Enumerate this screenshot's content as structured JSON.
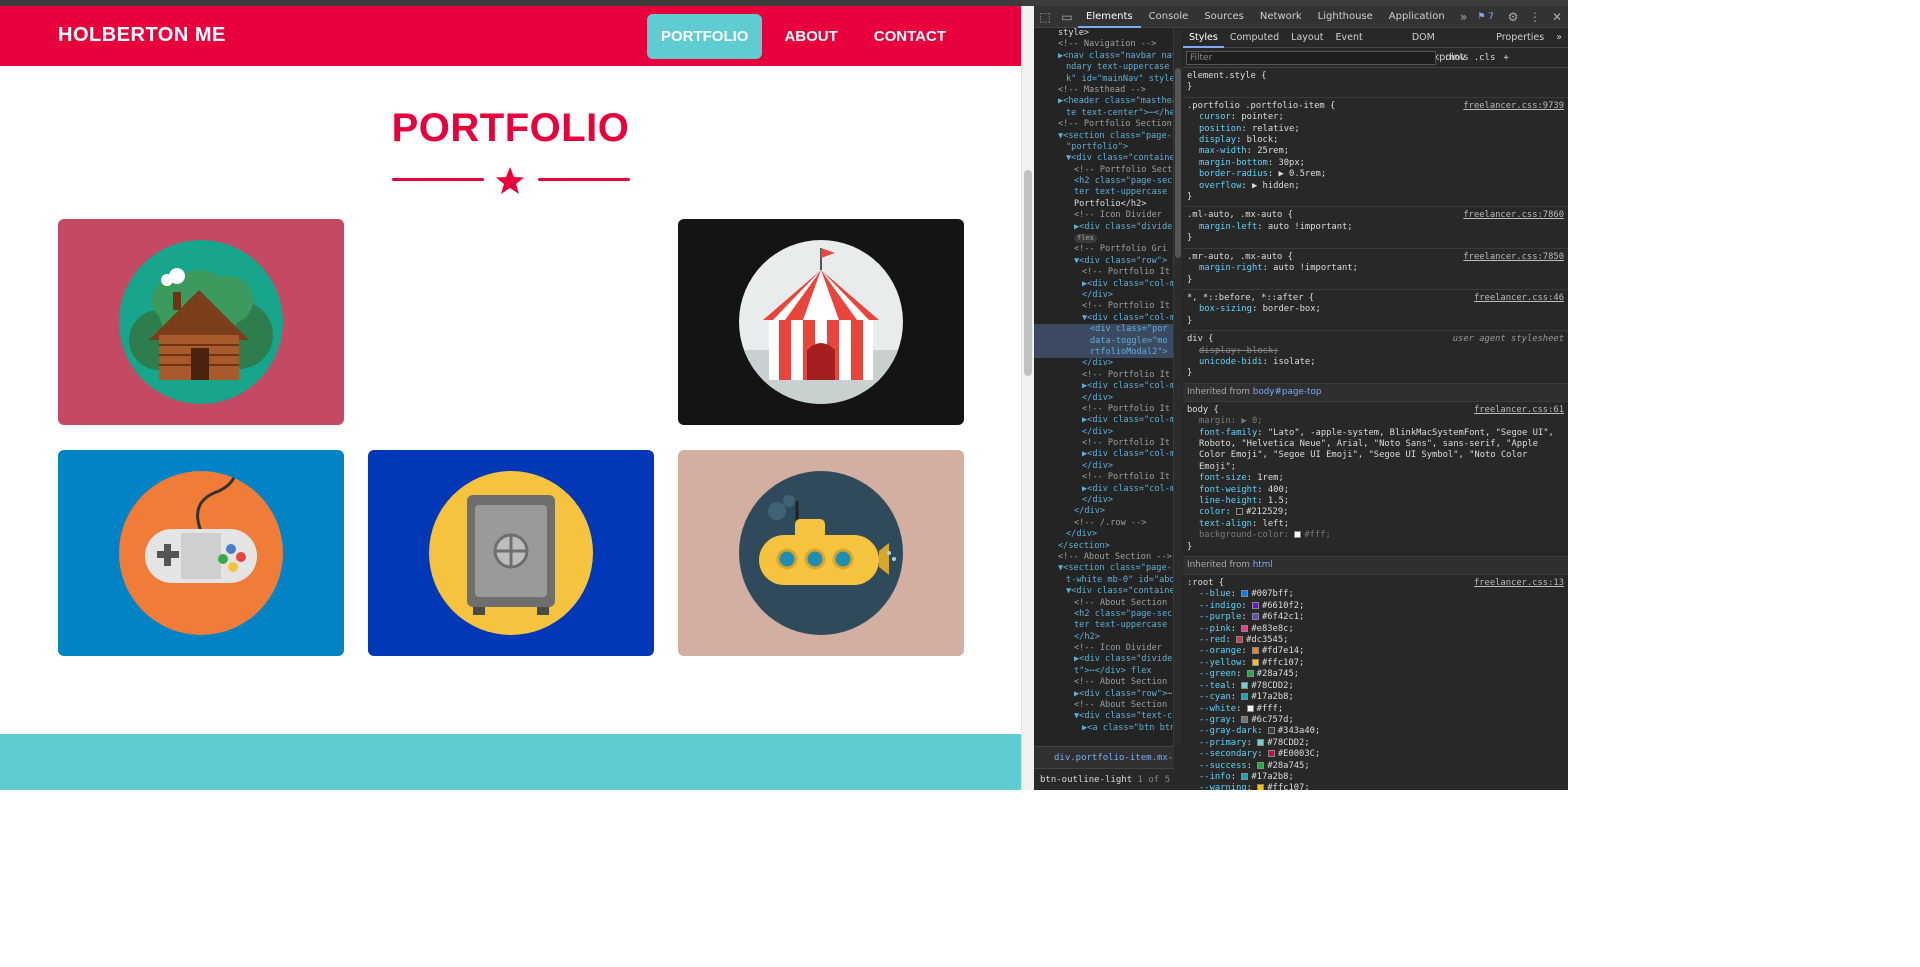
{
  "page": {
    "brand": "HOLBERTON ME",
    "nav": [
      "PORTFOLIO",
      "ABOUT",
      "CONTACT"
    ],
    "section_title": "PORTFOLIO",
    "tiles": [
      {
        "name": "cabin",
        "bg": "#C44A63",
        "circle": "#17A58C"
      },
      {
        "name": "circus",
        "bg": "#141414",
        "circle": "#E8ECEC"
      },
      {
        "name": "game-controller",
        "bg": "#0283C6",
        "circle": "#F07C37"
      },
      {
        "name": "safe",
        "bg": "#0038B8",
        "circle": "#F6C33F"
      },
      {
        "name": "submarine",
        "bg": "#D2AFA0",
        "circle": "#2F4A5A"
      }
    ],
    "colors": {
      "primary": "#E8003C",
      "accent": "#5ECCD0"
    }
  },
  "devtools": {
    "tabs": [
      "Elements",
      "Console",
      "Sources",
      "Network",
      "Lighthouse",
      "Application"
    ],
    "issues_count": "7",
    "style_tabs": [
      "Styles",
      "Computed",
      "Layout",
      "Event Listeners",
      "DOM Breakpoints",
      "Properties"
    ],
    "filter_placeholder": "Filter",
    "filter_tools": [
      ":hov",
      ".cls",
      "+"
    ],
    "breadcrumb": "div.portfolio-item.mx-auto",
    "search_value": "btn-outline-light",
    "search_count": "1 of 5",
    "elements": [
      {
        "t": "text",
        "s": "style>"
      },
      {
        "t": "comment",
        "s": "<!-- Navigation -->"
      },
      {
        "t": "tag",
        "s": "▶<nav class=\"navbar nav",
        "i": 0
      },
      {
        "t": "tag",
        "s": "ndary text-uppercase f",
        "i": 1
      },
      {
        "t": "tag",
        "s": "k\" id=\"mainNav\" style>",
        "i": 1
      },
      {
        "t": "comment",
        "s": "<!-- Masthead -->"
      },
      {
        "t": "tag",
        "s": "▶<header class=\"masthea",
        "i": 0
      },
      {
        "t": "tag",
        "s": "te text-center\">⋯</he",
        "i": 1
      },
      {
        "t": "comment",
        "s": "<!-- Portfolio Section"
      },
      {
        "t": "tag",
        "s": "▼<section class=\"page-s",
        "i": 0
      },
      {
        "t": "tag",
        "s": "\"portfolio\">",
        "i": 1
      },
      {
        "t": "tag",
        "s": "▼<div class=\"containe",
        "i": 1
      },
      {
        "t": "comment",
        "s": "<!-- Portfolio Sect",
        "i": 2
      },
      {
        "t": "tag",
        "s": "<h2 class=\"page-sec",
        "i": 2
      },
      {
        "t": "tag",
        "s": "ter text-uppercase",
        "i": 2
      },
      {
        "t": "text",
        "s": "Portfolio</h2>",
        "i": 2
      },
      {
        "t": "comment",
        "s": "<!-- Icon Divider",
        "i": 2
      },
      {
        "t": "tag",
        "s": "▶<div class=\"divide",
        "i": 2
      },
      {
        "t": "pill",
        "s": "flex",
        "i": 2
      },
      {
        "t": "comment",
        "s": "<!-- Portfolio Gri",
        "i": 2
      },
      {
        "t": "tag",
        "s": "▼<div class=\"row\">",
        "i": 2
      },
      {
        "t": "comment",
        "s": "<!-- Portfolio It",
        "i": 3
      },
      {
        "t": "tag",
        "s": "▶<div class=\"col-m",
        "i": 3
      },
      {
        "t": "tag",
        "s": "</div>",
        "i": 3
      },
      {
        "t": "comment",
        "s": "<!-- Portfolio It",
        "i": 3
      },
      {
        "t": "tag",
        "s": "▼<div class=\"col-m",
        "i": 3
      },
      {
        "t": "sel",
        "s": "<div class=\"por",
        "i": 4
      },
      {
        "t": "sel",
        "s": "data-toggle=\"mo",
        "i": 4
      },
      {
        "t": "sel",
        "s": "rtfolioModal2\">",
        "i": 4
      },
      {
        "t": "tag",
        "s": "</div>",
        "i": 3
      },
      {
        "t": "comment",
        "s": "<!-- Portfolio It",
        "i": 3
      },
      {
        "t": "tag",
        "s": "▶<div class=\"col-m",
        "i": 3
      },
      {
        "t": "tag",
        "s": "</div>",
        "i": 3
      },
      {
        "t": "comment",
        "s": "<!-- Portfolio It",
        "i": 3
      },
      {
        "t": "tag",
        "s": "▶<div class=\"col-m",
        "i": 3
      },
      {
        "t": "tag",
        "s": "</div>",
        "i": 3
      },
      {
        "t": "comment",
        "s": "<!-- Portfolio It",
        "i": 3
      },
      {
        "t": "tag",
        "s": "▶<div class=\"col-m",
        "i": 3
      },
      {
        "t": "tag",
        "s": "</div>",
        "i": 3
      },
      {
        "t": "comment",
        "s": "<!-- Portfolio It",
        "i": 3
      },
      {
        "t": "tag",
        "s": "▶<div class=\"col-m",
        "i": 3
      },
      {
        "t": "tag",
        "s": "</div>",
        "i": 3
      },
      {
        "t": "tag",
        "s": "</div>",
        "i": 2
      },
      {
        "t": "comment",
        "s": "<!-- /.row -->",
        "i": 2
      },
      {
        "t": "tag",
        "s": "</div>",
        "i": 1
      },
      {
        "t": "tag",
        "s": "</section>",
        "i": 0
      },
      {
        "t": "comment",
        "s": "<!-- About Section -->"
      },
      {
        "t": "tag",
        "s": "▼<section class=\"page-s",
        "i": 0
      },
      {
        "t": "tag",
        "s": "t-white mb-0\" id=\"abou",
        "i": 1
      },
      {
        "t": "tag",
        "s": "▼<div class=\"containe",
        "i": 1
      },
      {
        "t": "comment",
        "s": "<!-- About Section",
        "i": 2
      },
      {
        "t": "tag",
        "s": "<h2 class=\"page-sec",
        "i": 2
      },
      {
        "t": "tag",
        "s": "ter text-uppercase",
        "i": 2
      },
      {
        "t": "tag",
        "s": "</h2>",
        "i": 2
      },
      {
        "t": "comment",
        "s": "<!-- Icon Divider",
        "i": 2
      },
      {
        "t": "tag",
        "s": "▶<div class=\"divide",
        "i": 2
      },
      {
        "t": "tag",
        "s": "t\">⋯</div> flex",
        "i": 2
      },
      {
        "t": "comment",
        "s": "<!-- About Section",
        "i": 2
      },
      {
        "t": "tag",
        "s": "▶<div class=\"row\">⋯",
        "i": 2
      },
      {
        "t": "comment",
        "s": "<!-- About Section",
        "i": 2
      },
      {
        "t": "tag",
        "s": "▼<div class=\"text-c",
        "i": 2
      },
      {
        "t": "tag",
        "s": "▶<a class=\"btn btn",
        "i": 3
      }
    ],
    "rules": [
      {
        "selector": "element.style {",
        "src": "",
        "decls": []
      },
      {
        "selector": ".portfolio .portfolio-item {",
        "src": "freelancer.css:9739",
        "decls": [
          [
            "cursor",
            "pointer;"
          ],
          [
            "position",
            "relative;"
          ],
          [
            "display",
            "block;"
          ],
          [
            "max-width",
            "25rem;"
          ],
          [
            "margin-bottom",
            "30px;"
          ],
          [
            "border-radius",
            "▶ 0.5rem;"
          ],
          [
            "overflow",
            "▶ hidden;"
          ]
        ]
      },
      {
        "selector": ".ml-auto, .mx-auto {",
        "src": "freelancer.css:7860",
        "decls": [
          [
            "margin-left",
            "auto !important;"
          ]
        ]
      },
      {
        "selector": ".mr-auto, .mx-auto {",
        "src": "freelancer.css:7850",
        "decls": [
          [
            "margin-right",
            "auto !important;"
          ]
        ]
      },
      {
        "selector": "*, *::before, *::after {",
        "src": "freelancer.css:46",
        "decls": [
          [
            "box-sizing",
            "border-box;"
          ]
        ]
      },
      {
        "selector": "div {",
        "src": "user agent stylesheet",
        "ua": true,
        "decls": [
          [
            "display",
            "block;",
            "strike"
          ],
          [
            "unicode-bidi",
            "isolate;"
          ]
        ]
      }
    ],
    "inherited_body_label": "Inherited from",
    "inherited_body_link": "body#page-top",
    "body_rule": {
      "selector": "body {",
      "src": "freelancer.css:61",
      "decls": [
        [
          "margin",
          "▶ 0;",
          "dim"
        ],
        [
          "font-family",
          "\"Lato\", -apple-system, BlinkMacSystemFont, \"Segoe UI\", Roboto, \"Helvetica Neue\", Arial, \"Noto Sans\", sans-serif, \"Apple Color Emoji\", \"Segoe UI Emoji\", \"Segoe UI Symbol\", \"Noto Color Emoji\";"
        ],
        [
          "font-size",
          "1rem;"
        ],
        [
          "font-weight",
          "400;"
        ],
        [
          "line-height",
          "1.5;"
        ],
        [
          "color",
          "#212529;",
          "",
          "#212529"
        ],
        [
          "text-align",
          "left;"
        ],
        [
          "background-color",
          "#fff;",
          "dim",
          "#ffffff"
        ]
      ]
    },
    "inherited_html_label": "Inherited from",
    "inherited_html_link": "html",
    "root_rule": {
      "selector": ":root {",
      "src": "freelancer.css:13",
      "decls": [
        [
          "--blue",
          "#007bff;",
          "",
          "#007bff"
        ],
        [
          "--indigo",
          "#6610f2;",
          "",
          "#6610f2"
        ],
        [
          "--purple",
          "#6f42c1;",
          "",
          "#6f42c1"
        ],
        [
          "--pink",
          "#e83e8c;",
          "",
          "#e83e8c"
        ],
        [
          "--red",
          "#dc3545;",
          "",
          "#dc3545"
        ],
        [
          "--orange",
          "#fd7e14;",
          "",
          "#fd7e14"
        ],
        [
          "--yellow",
          "#ffc107;",
          "",
          "#ffc107"
        ],
        [
          "--green",
          "#28a745;",
          "",
          "#28a745"
        ],
        [
          "--teal",
          "#78CDD2;",
          "",
          "#78CDD2"
        ],
        [
          "--cyan",
          "#17a2b8;",
          "",
          "#17a2b8"
        ],
        [
          "--white",
          "#fff;",
          "",
          "#ffffff"
        ],
        [
          "--gray",
          "#6c757d;",
          "",
          "#6c757d"
        ],
        [
          "--gray-dark",
          "#343a40;",
          "",
          "#343a40"
        ],
        [
          "--primary",
          "#78CDD2;",
          "",
          "#78CDD2"
        ],
        [
          "--secondary",
          "#E0003C;",
          "",
          "#E0003C"
        ],
        [
          "--success",
          "#28a745;",
          "",
          "#28a745"
        ],
        [
          "--info",
          "#17a2b8;",
          "",
          "#17a2b8"
        ],
        [
          "--warning",
          "#ffc107;",
          "",
          "#ffc107"
        ]
      ]
    }
  }
}
